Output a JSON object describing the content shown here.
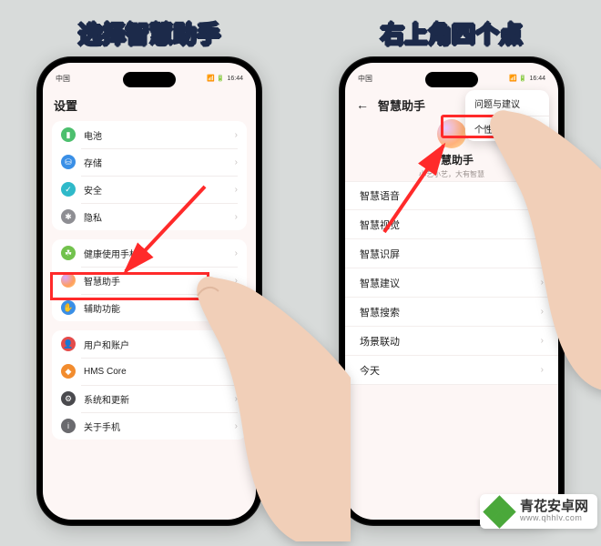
{
  "captions": {
    "left": "选择智慧助手",
    "right": "右上角四个点"
  },
  "statusbar": {
    "carrier": "中国",
    "time": "16:44",
    "right_icons": "📶 🔋"
  },
  "left_phone": {
    "title": "设置",
    "groups": [
      {
        "rows": [
          {
            "icon": "green",
            "name": "battery",
            "label": "电池"
          },
          {
            "icon": "blue",
            "name": "storage",
            "label": "存储"
          },
          {
            "icon": "teal",
            "name": "security",
            "label": "安全"
          },
          {
            "icon": "gray",
            "name": "privacy",
            "label": "隐私"
          }
        ]
      },
      {
        "rows": [
          {
            "icon": "lime",
            "name": "digital-balance",
            "label": "健康使用手机"
          },
          {
            "icon": "grad",
            "name": "smart-assistant",
            "label": "智慧助手"
          },
          {
            "icon": "blue",
            "name": "accessibility",
            "label": "辅助功能"
          }
        ]
      },
      {
        "rows": [
          {
            "icon": "red",
            "name": "users",
            "label": "用户和账户"
          },
          {
            "icon": "orange",
            "name": "hms",
            "label": "HMS Core"
          },
          {
            "icon": "dark",
            "name": "system",
            "label": "系统和更新"
          },
          {
            "icon": "info",
            "name": "about",
            "label": "关于手机"
          }
        ]
      }
    ]
  },
  "right_phone": {
    "title": "智慧助手",
    "hero_title": "智慧助手",
    "hero_sub": "小艺小艺，大有智慧",
    "popover": [
      {
        "name": "feedback",
        "label": "问题与建议"
      },
      {
        "name": "personalization",
        "label": "个性化设置"
      }
    ],
    "rows": [
      {
        "name": "voice",
        "label": "智慧语音"
      },
      {
        "name": "vision",
        "label": "智慧视觉"
      },
      {
        "name": "screen",
        "label": "智慧识屏"
      },
      {
        "name": "suggest",
        "label": "智慧建议"
      },
      {
        "name": "search",
        "label": "智慧搜索"
      },
      {
        "name": "scene",
        "label": "场景联动"
      },
      {
        "name": "today",
        "label": "今天"
      }
    ]
  },
  "watermark": {
    "title": "青花安卓网",
    "url": "www.qhhlv.com"
  }
}
